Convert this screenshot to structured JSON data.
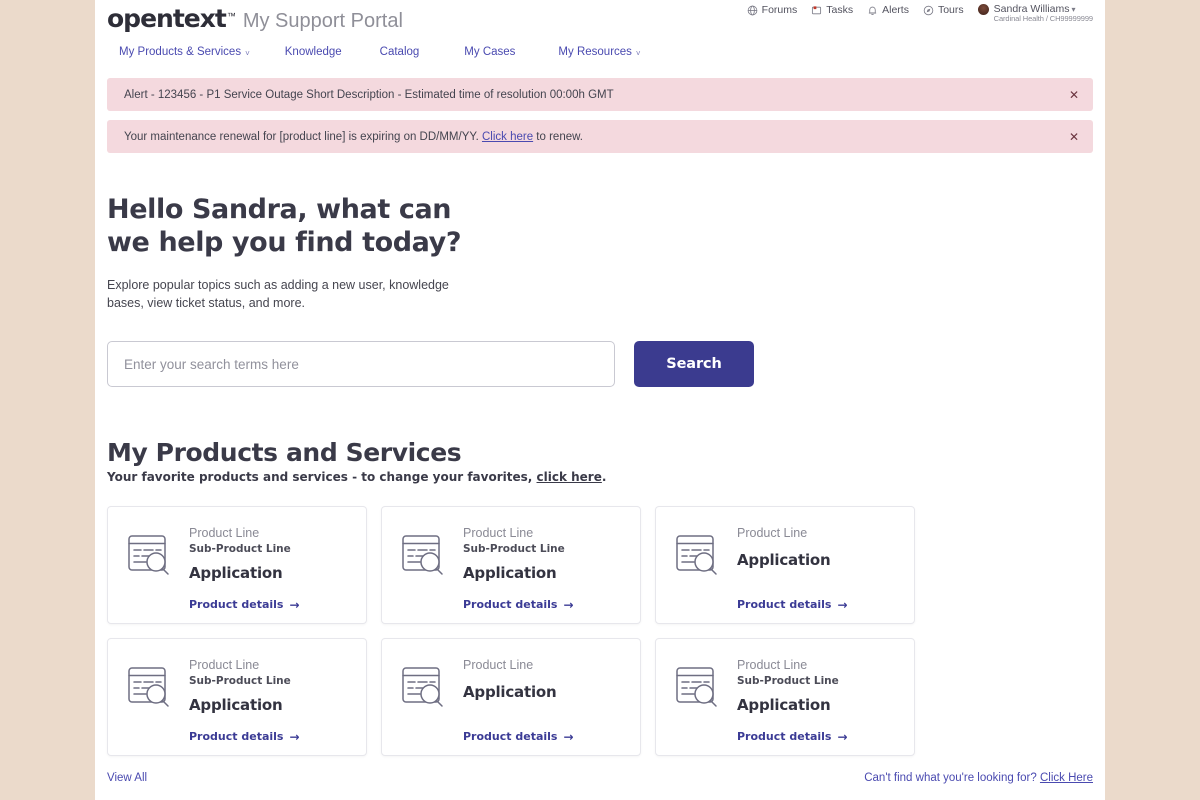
{
  "brand": {
    "wordmark": "opentext",
    "trademark": "™",
    "portal_name": "My Support Portal"
  },
  "util_nav": {
    "items": [
      {
        "label": "Forums",
        "icon": "globe-icon"
      },
      {
        "label": "Tasks",
        "icon": "tasks-icon"
      },
      {
        "label": "Alerts",
        "icon": "bell-icon"
      },
      {
        "label": "Tours",
        "icon": "tours-icon"
      }
    ],
    "user": {
      "name": "Sandra Williams",
      "caret": "▾",
      "org": "Cardinal Health / CH99999999"
    }
  },
  "main_nav": {
    "items": [
      {
        "label": "My Products & Services",
        "has_caret": true,
        "caret": "˅"
      },
      {
        "label": "Knowledge",
        "has_caret": false,
        "caret": ""
      },
      {
        "label": "Catalog",
        "has_caret": false,
        "caret": ""
      },
      {
        "label": "My Cases",
        "has_caret": false,
        "caret": ""
      },
      {
        "label": "My Resources",
        "has_caret": true,
        "caret": "˅"
      }
    ]
  },
  "alerts": [
    {
      "text": "Alert - 123456 - P1 Service Outage Short Description - Estimated time of resolution 00:00h GMT",
      "close": "✕"
    },
    {
      "text_before": "Your maintenance renewal for [product line] is expiring on DD/MM/YY. ",
      "link": "Click here",
      "text_after": " to renew.",
      "close": "✕"
    }
  ],
  "hero": {
    "heading": "Hello Sandra, what can we help you find today?",
    "subtext": "Explore popular topics such as adding a new user, knowledge bases, view ticket status, and more.",
    "search_placeholder": "Enter your search terms here",
    "search_value": "",
    "search_button": "Search"
  },
  "products": {
    "title": "My Products and Services",
    "sub_before": "Your favorite products and services - to change your favorites, ",
    "sub_link": "click here",
    "sub_after": ".",
    "details_label": "Product details",
    "details_arrow": "→",
    "cards": [
      {
        "product_line": "Product Line",
        "sub_product_line": "Sub-Product Line",
        "application": "Application"
      },
      {
        "product_line": "Product Line",
        "sub_product_line": "Sub-Product Line",
        "application": "Application"
      },
      {
        "product_line": "Product Line",
        "sub_product_line": "",
        "application": "Application"
      },
      {
        "product_line": "Product Line",
        "sub_product_line": "Sub-Product Line",
        "application": "Application"
      },
      {
        "product_line": "Product Line",
        "sub_product_line": "",
        "application": "Application"
      },
      {
        "product_line": "Product Line",
        "sub_product_line": "Sub-Product Line",
        "application": "Application"
      }
    ]
  },
  "footer": {
    "view_all": "View All",
    "help_text": "Can't find what you're looking for? ",
    "help_link": "Click Here"
  },
  "colors": {
    "accent_indigo": "#3b3b8f",
    "link_indigo": "#4a4ab0",
    "alert_bg": "#f4d9de",
    "page_bg": "#ffffff",
    "canvas_bg": "#ebdacb",
    "heading": "#3a3a48"
  }
}
